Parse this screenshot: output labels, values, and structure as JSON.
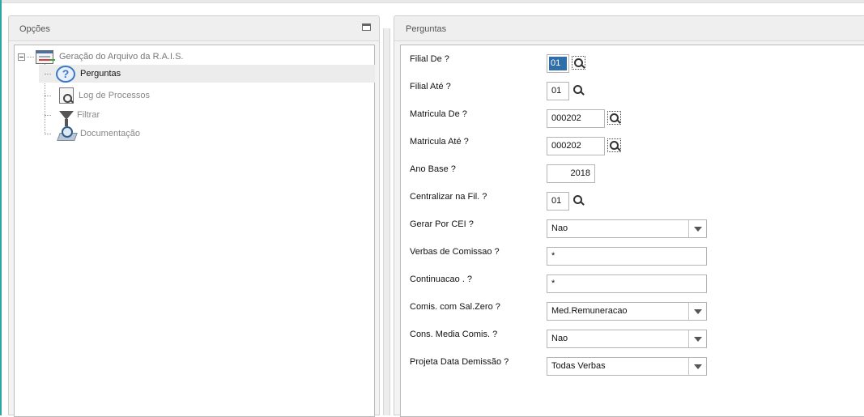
{
  "left_panel": {
    "title": "Opções",
    "tree": {
      "root": "Geração do Arquivo da R.A.I.S.",
      "items": [
        {
          "label": "Perguntas",
          "icon": "question-icon",
          "selected": true
        },
        {
          "label": "Log de Processos",
          "icon": "log-icon"
        },
        {
          "label": "Filtrar",
          "icon": "filter-icon"
        },
        {
          "label": "Documentação",
          "icon": "documentation-icon"
        }
      ]
    }
  },
  "right_panel": {
    "title": "Perguntas",
    "fields": [
      {
        "label": "Filial De ?",
        "value": "01"
      },
      {
        "label": "Filial Até ?",
        "value": "01"
      },
      {
        "label": "Matricula De ?",
        "value": "000202"
      },
      {
        "label": "Matricula Até ?",
        "value": "000202"
      },
      {
        "label": "Ano Base ?",
        "value": "2018"
      },
      {
        "label": "Centralizar na Fil. ?",
        "value": "01"
      },
      {
        "label": "Gerar Por CEI ?",
        "value": "Nao"
      },
      {
        "label": "Verbas de Comissao ?",
        "value": "*"
      },
      {
        "label": "Continuacao  . ?",
        "value": "*"
      },
      {
        "label": "Comis. com Sal.Zero ?",
        "value": "Med.Remuneracao"
      },
      {
        "label": "Cons. Media Comis. ?",
        "value": "Nao"
      },
      {
        "label": "Projeta Data Demissão ?",
        "value": "Todas Verbas"
      }
    ]
  }
}
